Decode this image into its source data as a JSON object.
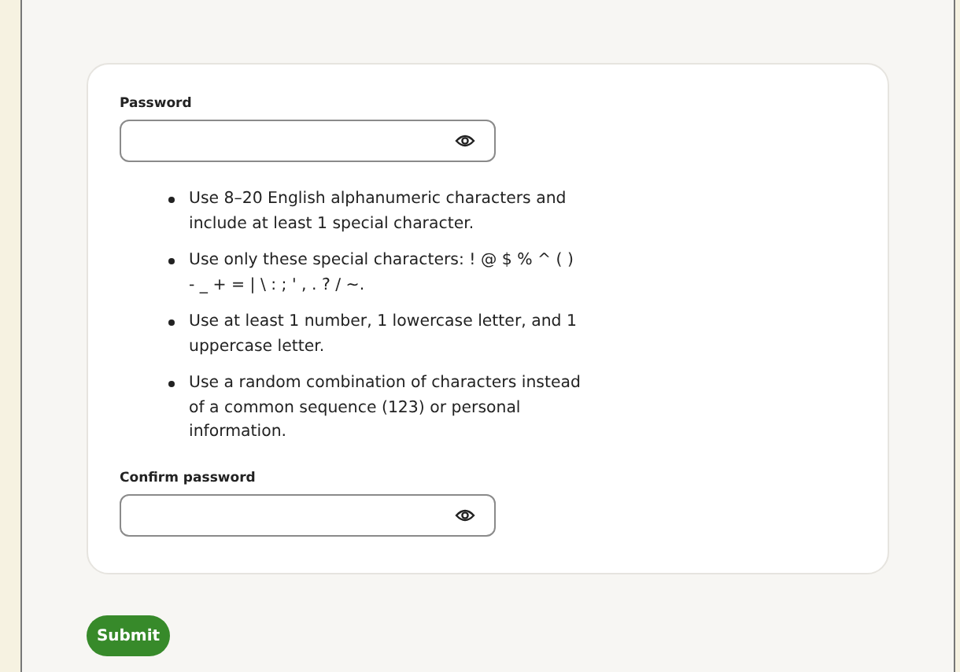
{
  "password_field": {
    "label": "Password"
  },
  "rules": [
    "Use 8–20 English alphanumeric characters and include at least 1 special character.",
    "Use only these special characters: ! @ $ % ^ ( ) - _ + = | \\ : ; ' , . ? / ~.",
    "Use at least 1 number, 1 lowercase letter, and 1 uppercase letter.",
    "Use a random combination of characters instead of a common sequence (123) or personal information."
  ],
  "confirm_field": {
    "label": "Confirm password"
  },
  "submit_button": {
    "label": "Submit"
  }
}
